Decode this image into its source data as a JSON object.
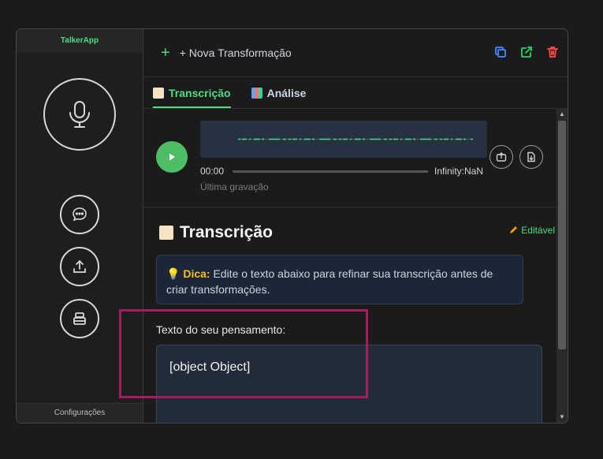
{
  "sidebar": {
    "brand": "TalkerApp",
    "settings_label": "Configurações",
    "icons": [
      "microphone-icon",
      "chat-bubble-icon",
      "upload-icon",
      "layers-icon"
    ]
  },
  "topbar": {
    "new_transformation_label": "+ Nova Transformação",
    "icons": [
      "copy-icon",
      "external-link-icon",
      "trash-icon"
    ]
  },
  "tabs": [
    {
      "label": "Transcrição",
      "active": true
    },
    {
      "label": "Análise",
      "active": false
    }
  ],
  "player": {
    "current_time": "00:00",
    "duration": "Infinity:NaN",
    "recording_label": "Última gravação",
    "progress": 0
  },
  "transcription": {
    "title": "Transcrição",
    "editable_label": "Editável",
    "tip_prefix": "Dica:",
    "tip_text": " Edite o texto abaixo para refinar sua transcrição antes de criar transformações.",
    "field_label": "Texto do seu pensamento:",
    "field_value": "[object Object]"
  },
  "colors": {
    "accent": "#4ade80",
    "highlight_box": "#a11f5e",
    "tip_background": "#1d2636"
  }
}
